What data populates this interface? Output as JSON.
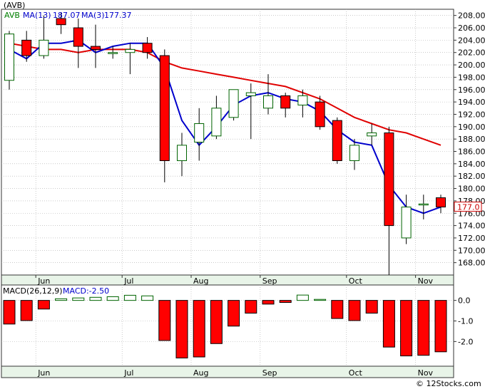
{
  "chart_data": {
    "type": "candlestick",
    "title": "(AVB)",
    "legend": [
      {
        "label": "AVB",
        "color": "#008000"
      },
      {
        "label": "MA(13)",
        "value": "187.07",
        "color": "#0000cc"
      },
      {
        "label": "MA(3)",
        "value": "177.37",
        "color": "#0000cc"
      }
    ],
    "price_axis": {
      "min": 166,
      "max": 209,
      "ticks": [
        168,
        170,
        172,
        174,
        176,
        178,
        180,
        182,
        184,
        186,
        188,
        190,
        192,
        194,
        196,
        198,
        200,
        202,
        204,
        206,
        208
      ]
    },
    "months": [
      {
        "label": "Jun",
        "week": 1
      },
      {
        "label": "Jul",
        "week": 6
      },
      {
        "label": "Aug",
        "week": 10
      },
      {
        "label": "Sep",
        "week": 14
      },
      {
        "label": "Oct",
        "week": 19
      },
      {
        "label": "Nov",
        "week": 23
      }
    ],
    "candles": [
      {
        "o": 197.5,
        "h": 205.5,
        "l": 196.0,
        "c": 205.0
      },
      {
        "o": 204.0,
        "h": 205.5,
        "l": 200.5,
        "c": 201.5
      },
      {
        "o": 201.5,
        "h": 208.0,
        "l": 201.0,
        "c": 204.0
      },
      {
        "o": 207.5,
        "h": 208.5,
        "l": 205.0,
        "c": 206.5
      },
      {
        "o": 206.0,
        "h": 207.5,
        "l": 199.5,
        "c": 203.0
      },
      {
        "o": 203.0,
        "h": 206.5,
        "l": 199.5,
        "c": 202.5
      },
      {
        "o": 202.0,
        "h": 203.0,
        "l": 201.0,
        "c": 202.0
      },
      {
        "o": 202.0,
        "h": 203.5,
        "l": 198.5,
        "c": 202.5
      },
      {
        "o": 203.5,
        "h": 204.5,
        "l": 201.0,
        "c": 202.0
      },
      {
        "o": 201.5,
        "h": 202.5,
        "l": 181.0,
        "c": 184.5
      },
      {
        "o": 184.5,
        "h": 189.0,
        "l": 182.0,
        "c": 187.0
      },
      {
        "o": 187.5,
        "h": 193.0,
        "l": 184.5,
        "c": 190.5
      },
      {
        "o": 188.5,
        "h": 195.0,
        "l": 188.0,
        "c": 193.0
      },
      {
        "o": 191.5,
        "h": 196.0,
        "l": 191.0,
        "c": 196.0
      },
      {
        "o": 195.0,
        "h": 197.0,
        "l": 188.0,
        "c": 195.5
      },
      {
        "o": 193.0,
        "h": 198.5,
        "l": 192.0,
        "c": 195.0
      },
      {
        "o": 195.0,
        "h": 195.5,
        "l": 191.5,
        "c": 193.0
      },
      {
        "o": 193.5,
        "h": 196.0,
        "l": 191.5,
        "c": 195.0
      },
      {
        "o": 194.0,
        "h": 195.0,
        "l": 189.5,
        "c": 190.0
      },
      {
        "o": 191.0,
        "h": 191.5,
        "l": 184.0,
        "c": 184.5
      },
      {
        "o": 184.5,
        "h": 188.0,
        "l": 183.0,
        "c": 187.0
      },
      {
        "o": 188.5,
        "h": 190.5,
        "l": 187.0,
        "c": 189.0
      },
      {
        "o": 189.0,
        "h": 190.0,
        "l": 166.0,
        "c": 174.0
      },
      {
        "o": 172.0,
        "h": 179.0,
        "l": 171.0,
        "c": 177.0
      },
      {
        "o": 177.5,
        "h": 179.0,
        "l": 175.0,
        "c": 177.5
      },
      {
        "o": 178.5,
        "h": 179.0,
        "l": 176.0,
        "c": 177.0
      }
    ],
    "ma13": [
      203.5,
      203.0,
      202.5,
      202.5,
      202.0,
      202.5,
      202.5,
      202.5,
      202.0,
      200.5,
      199.5,
      199.0,
      198.5,
      198.0,
      197.5,
      197.0,
      196.5,
      195.5,
      194.5,
      193.0,
      191.5,
      190.5,
      189.5,
      189.0,
      188.0,
      187.0
    ],
    "ma3": [
      202.5,
      201.0,
      203.5,
      203.5,
      204.0,
      202.0,
      203.0,
      203.5,
      203.5,
      199.5,
      191.0,
      187.0,
      190.0,
      193.5,
      195.0,
      195.5,
      194.5,
      194.0,
      192.5,
      189.5,
      187.5,
      187.0,
      180.5,
      177.0,
      176.0,
      177.0
    ],
    "last_price_label": "177.0",
    "macd": {
      "label": "MACD(26,12,9)",
      "value_label": "MACD:-2.50",
      "axis": {
        "min": -3.2,
        "max": 0.75,
        "ticks": [
          0.0,
          -1.0,
          -2.0
        ],
        "tick_labels": [
          "0.0",
          "-1.0",
          "-2.0"
        ]
      },
      "values": [
        -1.15,
        -0.98,
        -0.42,
        0.08,
        0.12,
        0.15,
        0.18,
        0.25,
        0.22,
        -1.95,
        -2.8,
        -2.75,
        -2.1,
        -1.25,
        -0.62,
        -0.18,
        -0.1,
        0.26,
        0.05,
        -0.88,
        -0.98,
        -0.62,
        -2.27,
        -2.7,
        -2.67,
        -2.5
      ]
    }
  }
}
